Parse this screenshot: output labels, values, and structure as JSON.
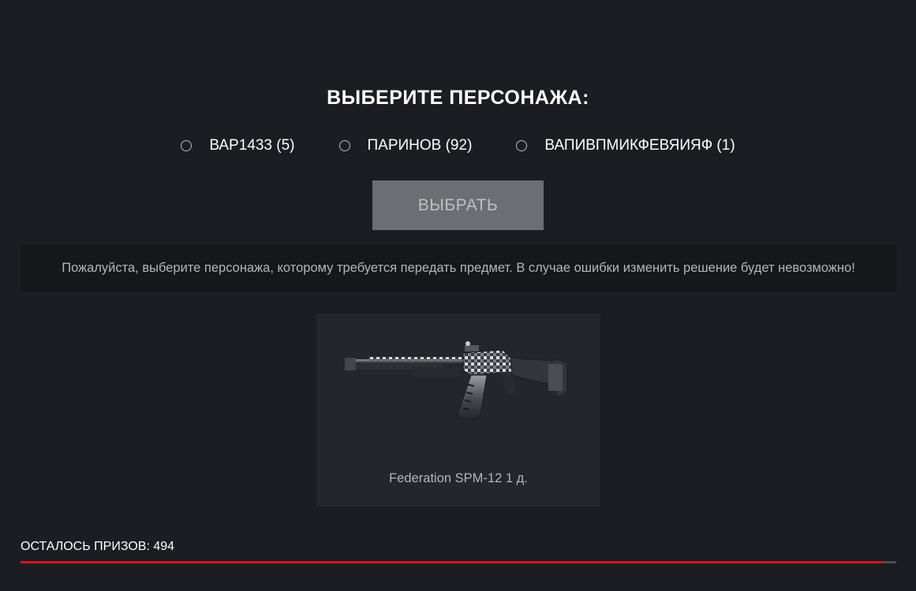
{
  "header": {
    "title": "ВЫБЕРИТЕ ПЕРСОНАЖА:"
  },
  "characters": [
    {
      "label": "ВАР1433 (5)",
      "selected": false
    },
    {
      "label": "ПАРИНОВ (92)",
      "selected": false
    },
    {
      "label": "ВАПИВПМИКФЕВЯИЯФ (1)",
      "selected": false
    }
  ],
  "select_button": {
    "label": "ВЫБРАТЬ"
  },
  "notice": {
    "text": "Пожалуйста, выберите персонажа, которому требуется передать предмет. В случае ошибки изменить решение будет невозможно!"
  },
  "prize": {
    "name": "Federation SPM-12 1 д.",
    "icon": "shotgun-icon"
  },
  "footer": {
    "remaining_text": "ОСТАЛОСЬ ПРИЗОВ: 494",
    "progress": 0.985
  },
  "colors": {
    "background": "#1c1d23",
    "button": "#6b6e72",
    "progress": "#d4161c",
    "card": "#25262d"
  }
}
